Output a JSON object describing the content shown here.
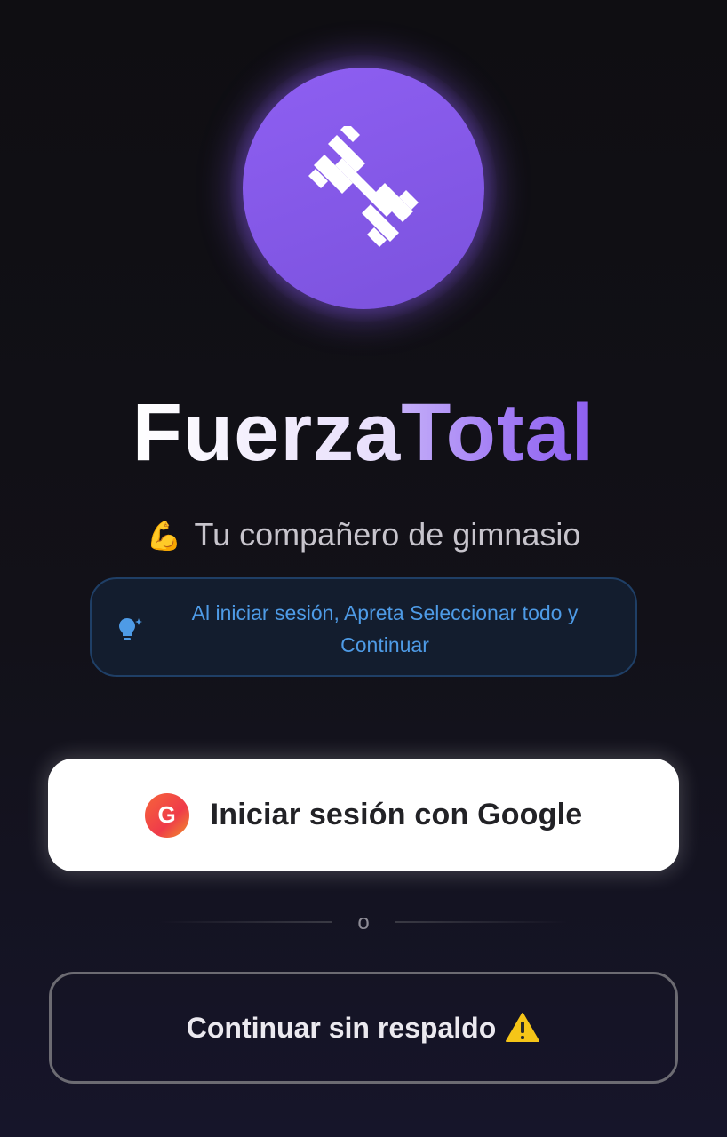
{
  "app": {
    "title_part1": "Fuerza",
    "title_part2": "Total",
    "tagline_emoji": "💪",
    "tagline": "Tu compañero de gimnasio",
    "logo_icon": "dumbbell-icon"
  },
  "hint": {
    "icon": "lightbulb-icon",
    "text": "Al iniciar sesión, Apreta Seleccionar todo y Continuar"
  },
  "google_button": {
    "badge": "G",
    "label": "Iniciar sesión con Google"
  },
  "divider": {
    "label": "o"
  },
  "skip_button": {
    "label": "Continuar sin respaldo",
    "icon": "warning-icon"
  },
  "colors": {
    "accent": "#8b5cf6",
    "background": "#121118",
    "hint_text": "#4e9be6",
    "hint_border": "#1f3f66"
  }
}
